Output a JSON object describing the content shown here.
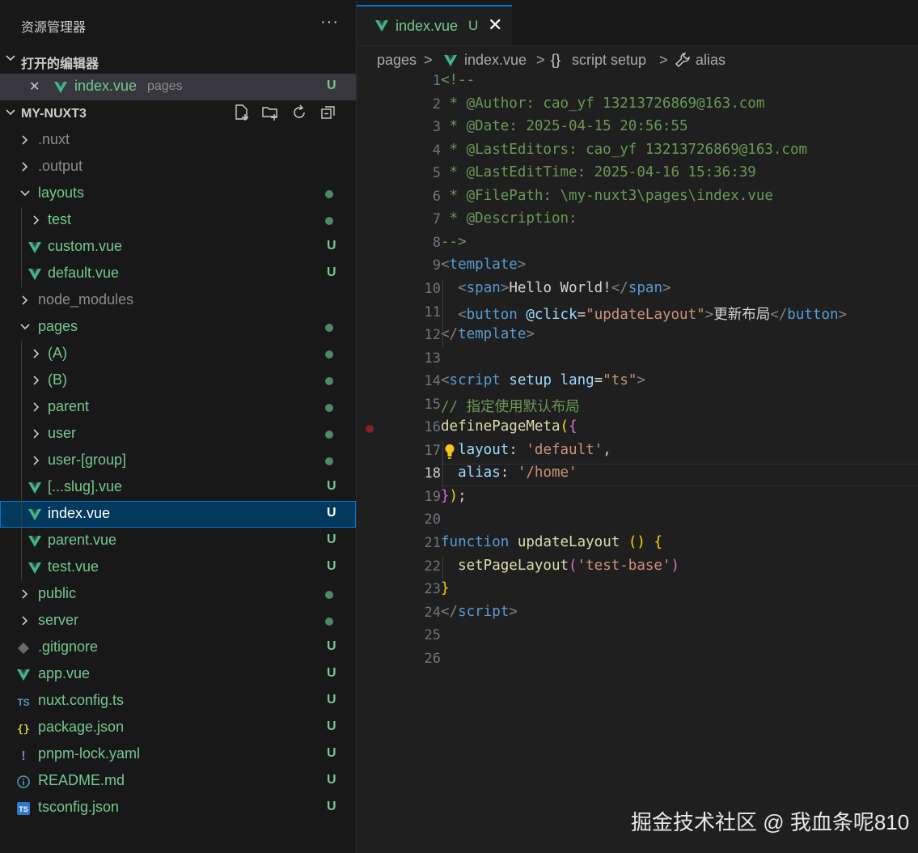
{
  "explorer": {
    "title": "资源管理器",
    "more": "···",
    "open_editors_label": "打开的编辑器",
    "open_editors": [
      {
        "close": "✕",
        "name": "index.vue",
        "desc": "pages",
        "badge": "U"
      }
    ],
    "project_label": "MY-NUXT3",
    "tree": [
      {
        "name": ".nuxt",
        "kind": "folder",
        "depth": 0,
        "expanded": false,
        "color": "#8c8c8c",
        "badge": ""
      },
      {
        "name": ".output",
        "kind": "folder",
        "depth": 0,
        "expanded": false,
        "color": "#8c8c8c",
        "badge": ""
      },
      {
        "name": "layouts",
        "kind": "folder",
        "depth": 0,
        "expanded": true,
        "color": "#73c991",
        "badge": "dot"
      },
      {
        "name": "test",
        "kind": "folder",
        "depth": 1,
        "expanded": false,
        "color": "#73c991",
        "badge": "dot"
      },
      {
        "name": "custom.vue",
        "kind": "vue",
        "depth": 1,
        "color": "#73c991",
        "badge": "U"
      },
      {
        "name": "default.vue",
        "kind": "vue",
        "depth": 1,
        "color": "#73c991",
        "badge": "U"
      },
      {
        "name": "node_modules",
        "kind": "folder",
        "depth": 0,
        "expanded": false,
        "color": "#8c8c8c",
        "badge": ""
      },
      {
        "name": "pages",
        "kind": "folder",
        "depth": 0,
        "expanded": true,
        "color": "#73c991",
        "badge": "dot"
      },
      {
        "name": "(A)",
        "kind": "folder",
        "depth": 1,
        "expanded": false,
        "color": "#73c991",
        "badge": "dot"
      },
      {
        "name": "(B)",
        "kind": "folder",
        "depth": 1,
        "expanded": false,
        "color": "#73c991",
        "badge": "dot"
      },
      {
        "name": "parent",
        "kind": "folder",
        "depth": 1,
        "expanded": false,
        "color": "#73c991",
        "badge": "dot"
      },
      {
        "name": "user",
        "kind": "folder",
        "depth": 1,
        "expanded": false,
        "color": "#73c991",
        "badge": "dot"
      },
      {
        "name": "user-[group]",
        "kind": "folder",
        "depth": 1,
        "expanded": false,
        "color": "#73c991",
        "badge": "dot"
      },
      {
        "name": "[...slug].vue",
        "kind": "vue",
        "depth": 1,
        "color": "#73c991",
        "badge": "U"
      },
      {
        "name": "index.vue",
        "kind": "vue",
        "depth": 1,
        "color": "#ffffff",
        "badge": "U",
        "selected": true
      },
      {
        "name": "parent.vue",
        "kind": "vue",
        "depth": 1,
        "color": "#73c991",
        "badge": "U"
      },
      {
        "name": "test.vue",
        "kind": "vue",
        "depth": 1,
        "color": "#73c991",
        "badge": "U"
      },
      {
        "name": "public",
        "kind": "folder",
        "depth": 0,
        "expanded": false,
        "color": "#73c991",
        "badge": "dot"
      },
      {
        "name": "server",
        "kind": "folder",
        "depth": 0,
        "expanded": false,
        "color": "#73c991",
        "badge": "dot"
      },
      {
        "name": ".gitignore",
        "kind": "git",
        "depth": 0,
        "color": "#73c991",
        "badge": "U"
      },
      {
        "name": "app.vue",
        "kind": "vue",
        "depth": 0,
        "color": "#73c991",
        "badge": "U"
      },
      {
        "name": "nuxt.config.ts",
        "kind": "ts",
        "depth": 0,
        "color": "#73c991",
        "badge": "U",
        "icon_text": "TS"
      },
      {
        "name": "package.json",
        "kind": "json",
        "depth": 0,
        "color": "#73c991",
        "badge": "U",
        "icon_text": "{}"
      },
      {
        "name": "pnpm-lock.yaml",
        "kind": "yaml",
        "depth": 0,
        "color": "#73c991",
        "badge": "U",
        "icon_text": "!"
      },
      {
        "name": "README.md",
        "kind": "info",
        "depth": 0,
        "color": "#73c991",
        "badge": "U"
      },
      {
        "name": "tsconfig.json",
        "kind": "tsconfig",
        "depth": 0,
        "color": "#73c991",
        "badge": "U",
        "icon_text": "TS"
      }
    ]
  },
  "tab": {
    "name": "index.vue",
    "status": "U",
    "close": "✕"
  },
  "breadcrumb": {
    "p1": "pages",
    "sep": ">",
    "p2": "index.vue",
    "p3": "script setup",
    "p3_icon": "{}",
    "p4": "alias"
  },
  "editor": {
    "active_line": 18,
    "breakpoint_line": 16,
    "lines": [
      [
        [
          "cm",
          "<!--"
        ]
      ],
      [
        [
          "cm",
          " * @Author: cao_yf 13213726869@163.com"
        ]
      ],
      [
        [
          "cm",
          " * @Date: 2025-04-15 20:56:55"
        ]
      ],
      [
        [
          "cm",
          " * @LastEditors: cao_yf 13213726869@163.com"
        ]
      ],
      [
        [
          "cm",
          " * @LastEditTime: 2025-04-16 15:36:39"
        ]
      ],
      [
        [
          "cm",
          " * @FilePath: \\my-nuxt3\\pages\\index.vue"
        ]
      ],
      [
        [
          "cm",
          " * @Description:"
        ]
      ],
      [
        [
          "cm",
          "-->"
        ]
      ],
      [
        [
          "br",
          "<"
        ],
        [
          "tag",
          "template"
        ],
        [
          "br",
          ">"
        ]
      ],
      [
        [
          "txt",
          "  "
        ],
        [
          "br",
          "<"
        ],
        [
          "tag",
          "span"
        ],
        [
          "br",
          ">"
        ],
        [
          "txt",
          "Hello World!"
        ],
        [
          "br",
          "</"
        ],
        [
          "tag",
          "span"
        ],
        [
          "br",
          ">"
        ]
      ],
      [
        [
          "txt",
          "  "
        ],
        [
          "br",
          "<"
        ],
        [
          "tag",
          "button"
        ],
        [
          "txt",
          " "
        ],
        [
          "at",
          "@click"
        ],
        [
          "txt",
          "="
        ],
        [
          "str",
          "\"updateLayout\""
        ],
        [
          "br",
          ">"
        ],
        [
          "txt",
          "更新布局"
        ],
        [
          "br",
          "</"
        ],
        [
          "tag",
          "button"
        ],
        [
          "br",
          ">"
        ]
      ],
      [
        [
          "br",
          "</"
        ],
        [
          "tag",
          "template"
        ],
        [
          "br",
          ">"
        ]
      ],
      [],
      [
        [
          "br",
          "<"
        ],
        [
          "tag",
          "script"
        ],
        [
          "txt",
          " "
        ],
        [
          "at",
          "setup"
        ],
        [
          "txt",
          " "
        ],
        [
          "at",
          "lang"
        ],
        [
          "txt",
          "="
        ],
        [
          "str",
          "\"ts\""
        ],
        [
          "br",
          ">"
        ]
      ],
      [
        [
          "cm",
          "// 指定使用默认布局"
        ]
      ],
      [
        [
          "fn",
          "definePageMeta"
        ],
        [
          "b1",
          "("
        ],
        [
          "b2",
          "{"
        ]
      ],
      [
        [
          "txt",
          "  "
        ],
        [
          "at",
          "layout"
        ],
        [
          "txt",
          ": "
        ],
        [
          "str",
          "'default'"
        ],
        [
          "txt",
          ","
        ]
      ],
      [
        [
          "txt",
          "  "
        ],
        [
          "at",
          "alias"
        ],
        [
          "txt",
          ": "
        ],
        [
          "str",
          "'/home'"
        ]
      ],
      [
        [
          "b2",
          "}"
        ],
        [
          "b1",
          ")"
        ],
        [
          "txt",
          ";"
        ]
      ],
      [],
      [
        [
          "kw",
          "function"
        ],
        [
          "txt",
          " "
        ],
        [
          "fn",
          "updateLayout"
        ],
        [
          "txt",
          " "
        ],
        [
          "b1",
          "()"
        ],
        [
          "txt",
          " "
        ],
        [
          "b1",
          "{"
        ]
      ],
      [
        [
          "txt",
          "  "
        ],
        [
          "fn",
          "setPageLayout"
        ],
        [
          "b2",
          "("
        ],
        [
          "str",
          "'test-base'"
        ],
        [
          "b2",
          ")"
        ]
      ],
      [
        [
          "b1",
          "}"
        ]
      ],
      [
        [
          "br",
          "</"
        ],
        [
          "tag",
          "script"
        ],
        [
          "br",
          ">"
        ]
      ],
      [],
      []
    ]
  },
  "watermark": "掘金技术社区 @ 我血条呢810",
  "colors": {
    "accent": "#0078d4",
    "git_added": "#73c991",
    "bulb": "#f5c518"
  }
}
